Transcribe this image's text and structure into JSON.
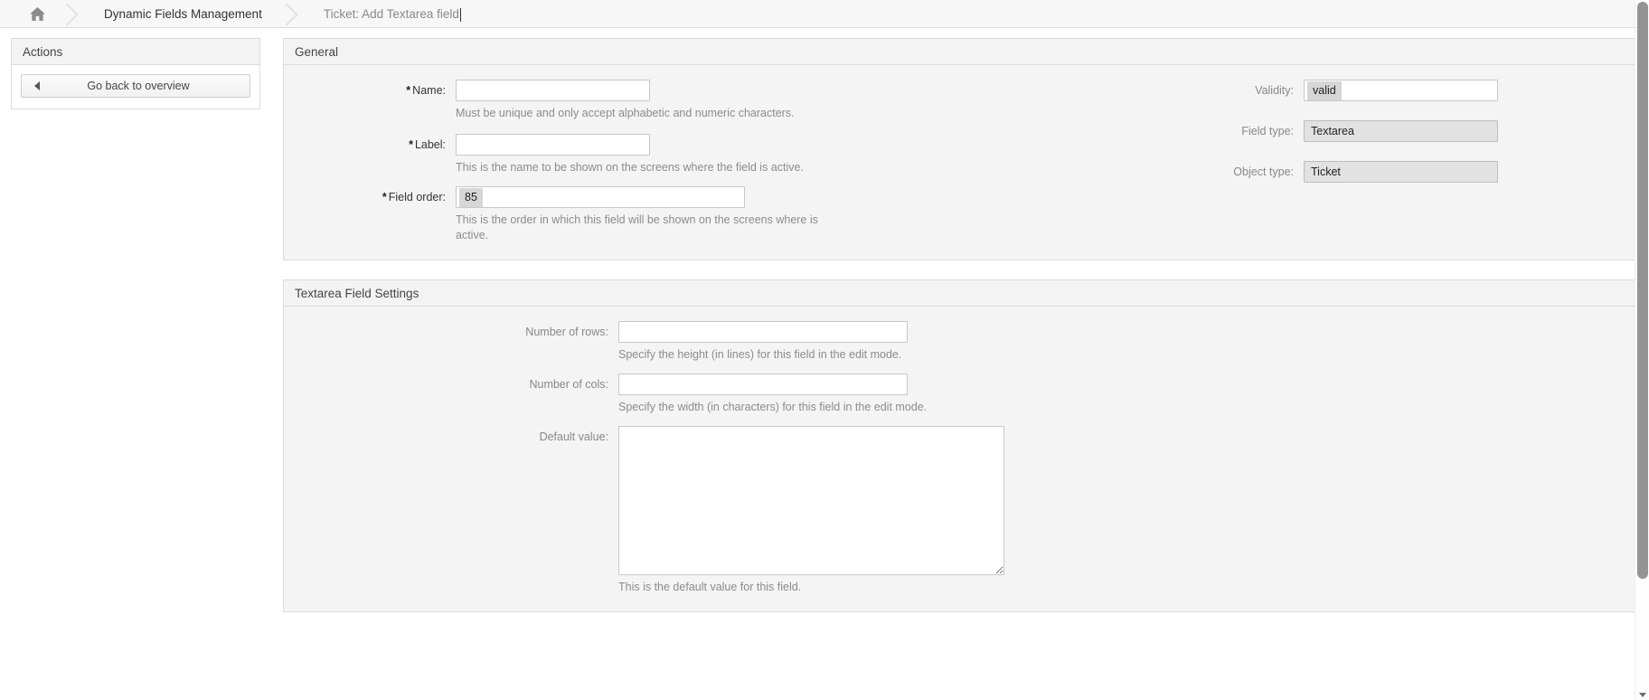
{
  "breadcrumb": {
    "home_icon": "home-icon",
    "items": [
      {
        "label": "Dynamic Fields Management",
        "current": false
      },
      {
        "label": "Ticket: Add Textarea field",
        "current": true
      }
    ]
  },
  "sidebar": {
    "title": "Actions",
    "back_button": {
      "label": "Go back to overview",
      "icon": "arrow-left-icon"
    }
  },
  "general": {
    "title": "General",
    "name": {
      "label": "Name:",
      "required": "*",
      "value": "",
      "placeholder": "",
      "hint": "Must be unique and only accept alphabetic and numeric characters."
    },
    "field_label": {
      "label": "Label:",
      "required": "*",
      "value": "",
      "placeholder": "",
      "hint": "This is the name to be shown on the screens where the field is active."
    },
    "field_order": {
      "label": "Field order:",
      "required": "*",
      "value": "85",
      "hint": "This is the order in which this field will be shown on the screens where is active."
    },
    "validity": {
      "label": "Validity:",
      "value": "valid"
    },
    "field_type": {
      "label": "Field type:",
      "value": "Textarea"
    },
    "object_type": {
      "label": "Object type:",
      "value": "Ticket"
    }
  },
  "textarea_settings": {
    "title": "Textarea Field Settings",
    "rows": {
      "label": "Number of rows:",
      "value": "",
      "hint": "Specify the height (in lines) for this field in the edit mode."
    },
    "cols": {
      "label": "Number of cols:",
      "value": "",
      "hint": "Specify the width (in characters) for this field in the edit mode."
    },
    "default_value": {
      "label": "Default value:",
      "value": "",
      "hint": "This is the default value for this field."
    }
  },
  "colors": {
    "panel_bg": "#f4f4f4",
    "border": "#dcdcdc",
    "label_text": "#888888",
    "hint_text": "#8c8c8c",
    "token_bg": "#d6d6d6",
    "disabled_bg": "#e2e2e2",
    "scrollbar_thumb": "#949494"
  }
}
